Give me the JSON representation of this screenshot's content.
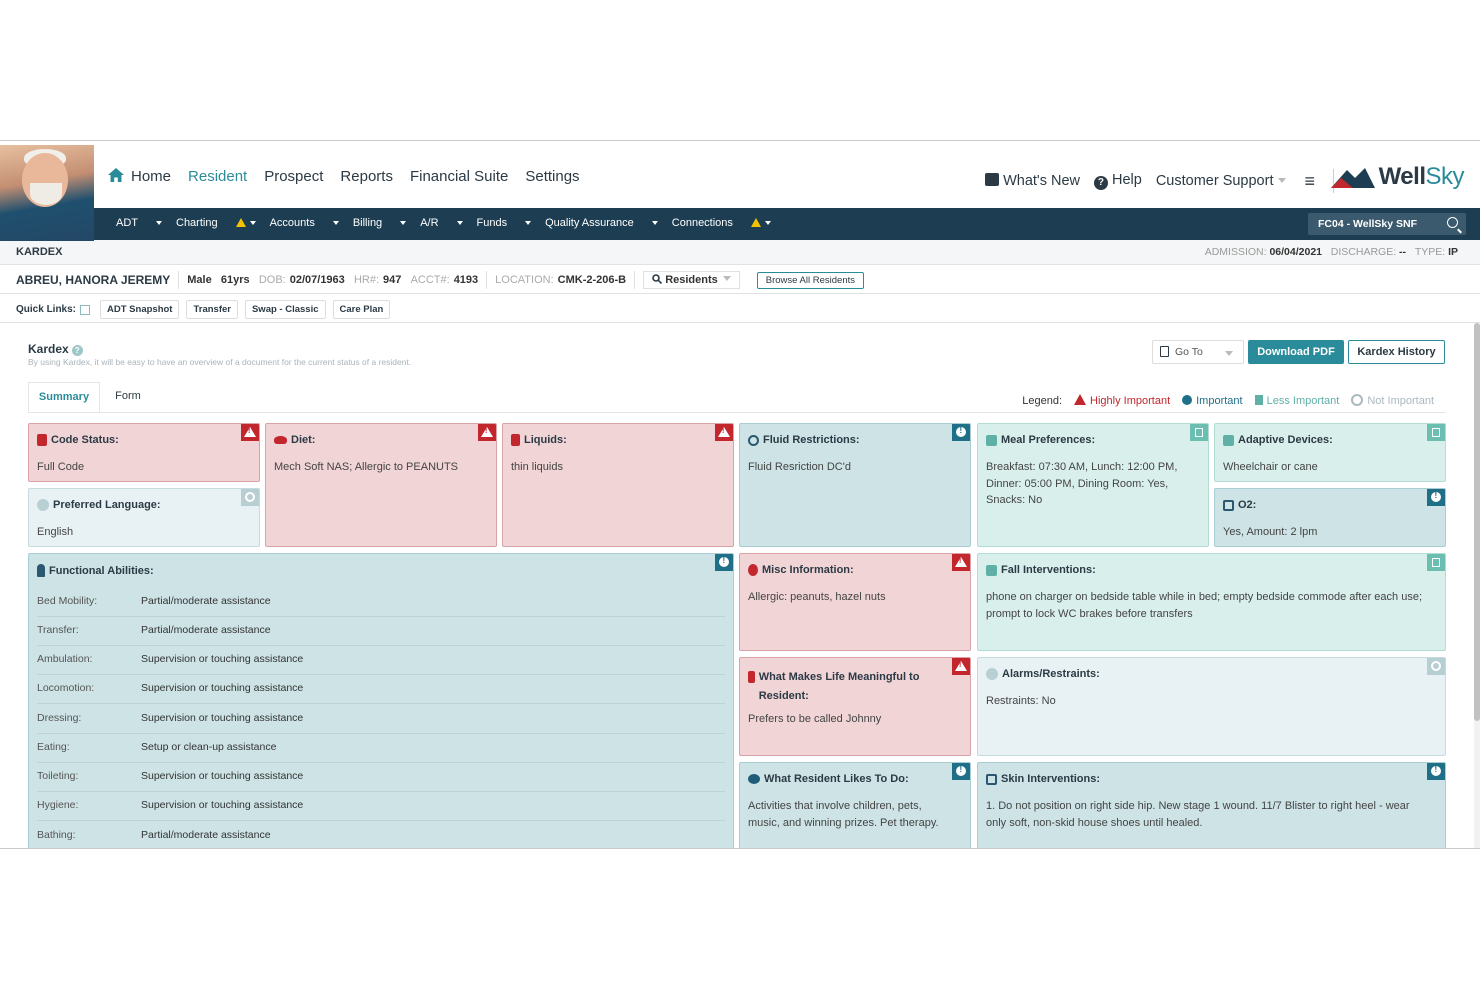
{
  "nav": {
    "home": "Home",
    "resident": "Resident",
    "prospect": "Prospect",
    "reports": "Reports",
    "financial": "Financial Suite",
    "settings": "Settings",
    "whats_new": "What's New",
    "help": "Help",
    "support": "Customer Support",
    "logo_a": "Well",
    "logo_b": "Sky"
  },
  "subnav": {
    "items": [
      "ADT",
      "Charting",
      "Accounts",
      "Billing",
      "A/R",
      "Funds",
      "Quality Assurance",
      "Connections"
    ],
    "facility": "FC04 - WellSky SNF"
  },
  "header": {
    "title": "KARDEX",
    "admission_label": "ADMISSION:",
    "admission": "06/04/2021",
    "discharge_label": "DISCHARGE:",
    "discharge": "--",
    "type_label": "TYPE:",
    "type": "IP"
  },
  "patient": {
    "name": "ABREU, HANORA JEREMY",
    "sex": "Male",
    "age": "61yrs",
    "dob_label": "DOB:",
    "dob": "02/07/1963",
    "hr_label": "HR#:",
    "hr": "947",
    "acct_label": "ACCT#:",
    "acct": "4193",
    "loc_label": "LOCATION:",
    "location": "CMK-2-206-B",
    "residents_btn": "Residents",
    "browse_btn": "Browse All Residents"
  },
  "quick_links": {
    "label": "Quick Links:",
    "items": [
      "ADT Snapshot",
      "Transfer",
      "Swap - Classic",
      "Care Plan"
    ]
  },
  "kardex": {
    "title": "Kardex",
    "subtitle": "By using Kardex, it will be easy to have an overview of a document for the current status of a resident.",
    "goto": "Go To",
    "download": "Download PDF",
    "history": "Kardex History",
    "tabs": [
      "Summary",
      "Form"
    ],
    "legend_label": "Legend:",
    "legend": [
      "Highly Important",
      "Important",
      "Less Important",
      "Not Important"
    ]
  },
  "cards": {
    "code_status": {
      "title": "Code Status:",
      "body": "Full Code"
    },
    "language": {
      "title": "Preferred Language:",
      "body": "English"
    },
    "diet": {
      "title": "Diet:",
      "body": "Mech Soft NAS; Allergic to PEANUTS"
    },
    "liquids": {
      "title": "Liquids:",
      "body": "thin liquids"
    },
    "fluid": {
      "title": "Fluid Restrictions:",
      "body": "Fluid Resriction DC'd"
    },
    "meal": {
      "title": "Meal Preferences:",
      "body": "Breakfast: 07:30 AM, Lunch: 12:00 PM, Dinner: 05:00 PM, Dining Room: Yes, Snacks: No"
    },
    "adaptive": {
      "title": "Adaptive Devices:",
      "body": "Wheelchair or cane"
    },
    "o2": {
      "title": "O2:",
      "body": "Yes, Amount: 2 lpm"
    },
    "functional": {
      "title": "Functional Abilities:",
      "rows": [
        {
          "label": "Bed Mobility:",
          "value": "Partial/moderate assistance"
        },
        {
          "label": "Transfer:",
          "value": "Partial/moderate assistance"
        },
        {
          "label": "Ambulation:",
          "value": "Supervision or touching assistance"
        },
        {
          "label": "Locomotion:",
          "value": "Supervision or touching assistance"
        },
        {
          "label": "Dressing:",
          "value": "Supervision or touching assistance"
        },
        {
          "label": "Eating:",
          "value": "Setup or clean-up assistance"
        },
        {
          "label": "Toileting:",
          "value": "Supervision or touching assistance"
        },
        {
          "label": "Hygiene:",
          "value": "Supervision or touching assistance"
        },
        {
          "label": "Bathing:",
          "value": "Partial/moderate assistance"
        }
      ]
    },
    "misc": {
      "title": "Misc Information:",
      "body": "Allergic: peanuts, hazel nuts"
    },
    "fall": {
      "title": "Fall Interventions:",
      "body": "phone on charger on bedside table while in bed; empty bedside commode after each use; prompt to lock WC brakes before transfers"
    },
    "meaningful": {
      "title": "What Makes Life Meaningful to Resident:",
      "body": "Prefers to be called Johnny"
    },
    "alarms": {
      "title": "Alarms/Restraints:",
      "body": "Restraints: No"
    },
    "likes": {
      "title": "What Resident Likes To Do:",
      "body": "Activities that involve children, pets, music, and winning prizes. Pet therapy."
    },
    "skin": {
      "title": "Skin Interventions:",
      "body": "1. Do not position on right side hip. New stage 1 wound. 11/7 Blister to right heel - wear only soft, non-skid house shoes until healed."
    }
  },
  "colors": {
    "accent": "#2a8c9b",
    "navy": "#1d3e52",
    "highly_important": "#c1272d",
    "important": "#1f6f88",
    "less_important": "#5fb0a7",
    "not_important": "#aab8bf"
  }
}
